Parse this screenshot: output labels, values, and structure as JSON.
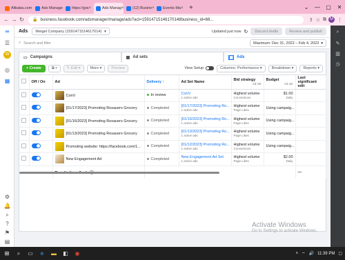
{
  "browser": {
    "tabs": [
      {
        "label": "Alibaba.com",
        "color": "#ff6a00",
        "active": false
      },
      {
        "label": "Ads Manage",
        "color": "#1877f2",
        "active": false
      },
      {
        "label": "https://gra",
        "color": "#1877f2",
        "active": false
      },
      {
        "label": "Ads Manag",
        "color": "#1877f2",
        "active": true
      },
      {
        "label": "(12) Busine",
        "color": "#1877f2",
        "active": false
      },
      {
        "label": "Events Ma",
        "color": "#1877f2",
        "active": false
      }
    ],
    "new_tab": "+",
    "url": "business.facebook.com/adsmanager/manage/ads?act=15914715146170148business_id=68...",
    "profile_initial": "M"
  },
  "ads_manager": {
    "title": "Ads",
    "account": "Weigel Company (1591471514617014)",
    "updated": "Updated just now",
    "discard": "Discard drafts",
    "review": "Review and publish",
    "search_placeholder": "Search and filter",
    "date_range": "Maximum: Dec 31, 2022 – Feb 4, 2023",
    "level_tabs": [
      {
        "label": "Campaigns",
        "active": false
      },
      {
        "label": "Ad sets",
        "active": false
      },
      {
        "label": "Ads",
        "active": true
      }
    ],
    "toolbar": {
      "create": "+ Create",
      "duplicate": "⧉ ▾",
      "edit": "✎ Edit ▾",
      "more": "More ▾",
      "preview": "Preview",
      "view_setup": "View Setup",
      "columns": "Columns: Performance ▾",
      "breakdown": "Breakdown ▾",
      "reports": "Reports ▾"
    },
    "columns": [
      "Off / On",
      "Ad",
      "Delivery ↑",
      "Ad Set Name",
      "Bid strategy",
      "Budget",
      "Last significant edit"
    ],
    "rows": [
      {
        "ad": "ConV",
        "thumb": "brown",
        "delivery": "In review",
        "delivery_color": "#42b72a",
        "adset": "ConV",
        "adset_sub": "1 active ads",
        "bid": "Highest volume",
        "bid_sub": "Conversions",
        "budget": "$1.00",
        "budget_sub": "Daily"
      },
      {
        "ad": "[01/17/2023] Promoting Rosauers Grocery",
        "thumb": "brown",
        "delivery": "Completed",
        "delivery_color": "#8a8d91",
        "adset": "[01/17/2023] Promoting Ro...",
        "adset_sub": "1 active ads",
        "bid": "Highest volume",
        "bid_sub": "Page Likes",
        "budget": "Using campaig...",
        "budget_sub": ""
      },
      {
        "ad": "[01/16/2023] Promoting Rosauers Grocery",
        "thumb": "yellow",
        "delivery": "Completed",
        "delivery_color": "#8a8d91",
        "adset": "[01/16/2023] Promoting Ro...",
        "adset_sub": "1 active ads",
        "bid": "Highest volume",
        "bid_sub": "Page Likes",
        "budget": "Using campaig...",
        "budget_sub": ""
      },
      {
        "ad": "[01/13/2023] Promoting Rosauers Grocery",
        "thumb": "yellow",
        "delivery": "Completed",
        "delivery_color": "#8a8d91",
        "adset": "[01/13/2023] Promoting Ro...",
        "adset_sub": "1 active ads",
        "bid": "Highest volume",
        "bid_sub": "Page Likes",
        "budget": "Using campaig...",
        "budget_sub": ""
      },
      {
        "ad": "Promoting website: https://facebook.com/1...",
        "thumb": "yellow",
        "delivery": "Completed",
        "delivery_color": "#8a8d91",
        "adset": "[01/12/2023] Promoting Ro...",
        "adset_sub": "1 active ads",
        "bid": "Highest volume",
        "bid_sub": "Conversions",
        "budget": "Using campaig...",
        "budget_sub": ""
      },
      {
        "ad": "New Engagement Ad",
        "thumb": "cup",
        "delivery": "Completed",
        "delivery_color": "#8a8d91",
        "adset": "New Engagement Ad Set",
        "adset_sub": "1 active ads",
        "bid": "Highest volume",
        "bid_sub": "Page Likes",
        "budget": "$2.00",
        "budget_sub": "Daily"
      }
    ],
    "results_label": "Results from 6 ads ⓘ",
    "results_last": "—",
    "bid_header_sub": "Ad set",
    "budget_header_sub": "Ad set"
  },
  "watermark": {
    "line1": "Activate Windows",
    "line2": "Go to Settings to activate Windows."
  },
  "taskbar": {
    "time": "11:39 PM"
  }
}
